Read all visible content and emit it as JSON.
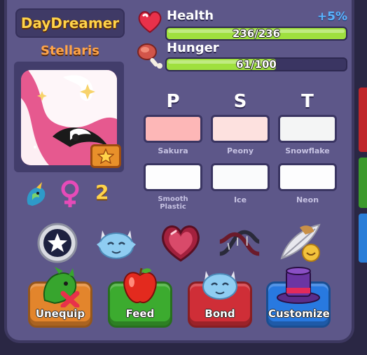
{
  "owner": {
    "name": "DayDreamer"
  },
  "pet": {
    "name": "Stellaris",
    "age": "2"
  },
  "stats": {
    "bonus": "+5%",
    "health": {
      "label": "Health",
      "value": "236/236",
      "fraction": 1.0
    },
    "hunger": {
      "label": "Hunger",
      "value": "61/100",
      "fraction": 0.61
    }
  },
  "columns": [
    "P",
    "S",
    "T"
  ],
  "swatches": [
    {
      "label": "Sakura",
      "color": "#fdb7b7"
    },
    {
      "label": "Peony",
      "color": "#fde1df"
    },
    {
      "label": "Snowflake",
      "color": "#f4f5f5"
    },
    {
      "label": "Smooth Plastic",
      "color": "#fdfdfe"
    },
    {
      "label": "Ice",
      "color": "#fafbfc"
    },
    {
      "label": "Neon",
      "color": "#fdfdfe"
    }
  ],
  "icons": [
    "star-badge-icon",
    "dragon-face-icon",
    "heart-gem-icon",
    "dna-icon",
    "feather-hat-icon"
  ],
  "actions": [
    {
      "label": "Unequip",
      "color": "#e3852c"
    },
    {
      "label": "Feed",
      "color": "#3cab2f"
    },
    {
      "label": "Bond",
      "color": "#cf2e37"
    },
    {
      "label": "Customize",
      "color": "#2879e0"
    }
  ]
}
